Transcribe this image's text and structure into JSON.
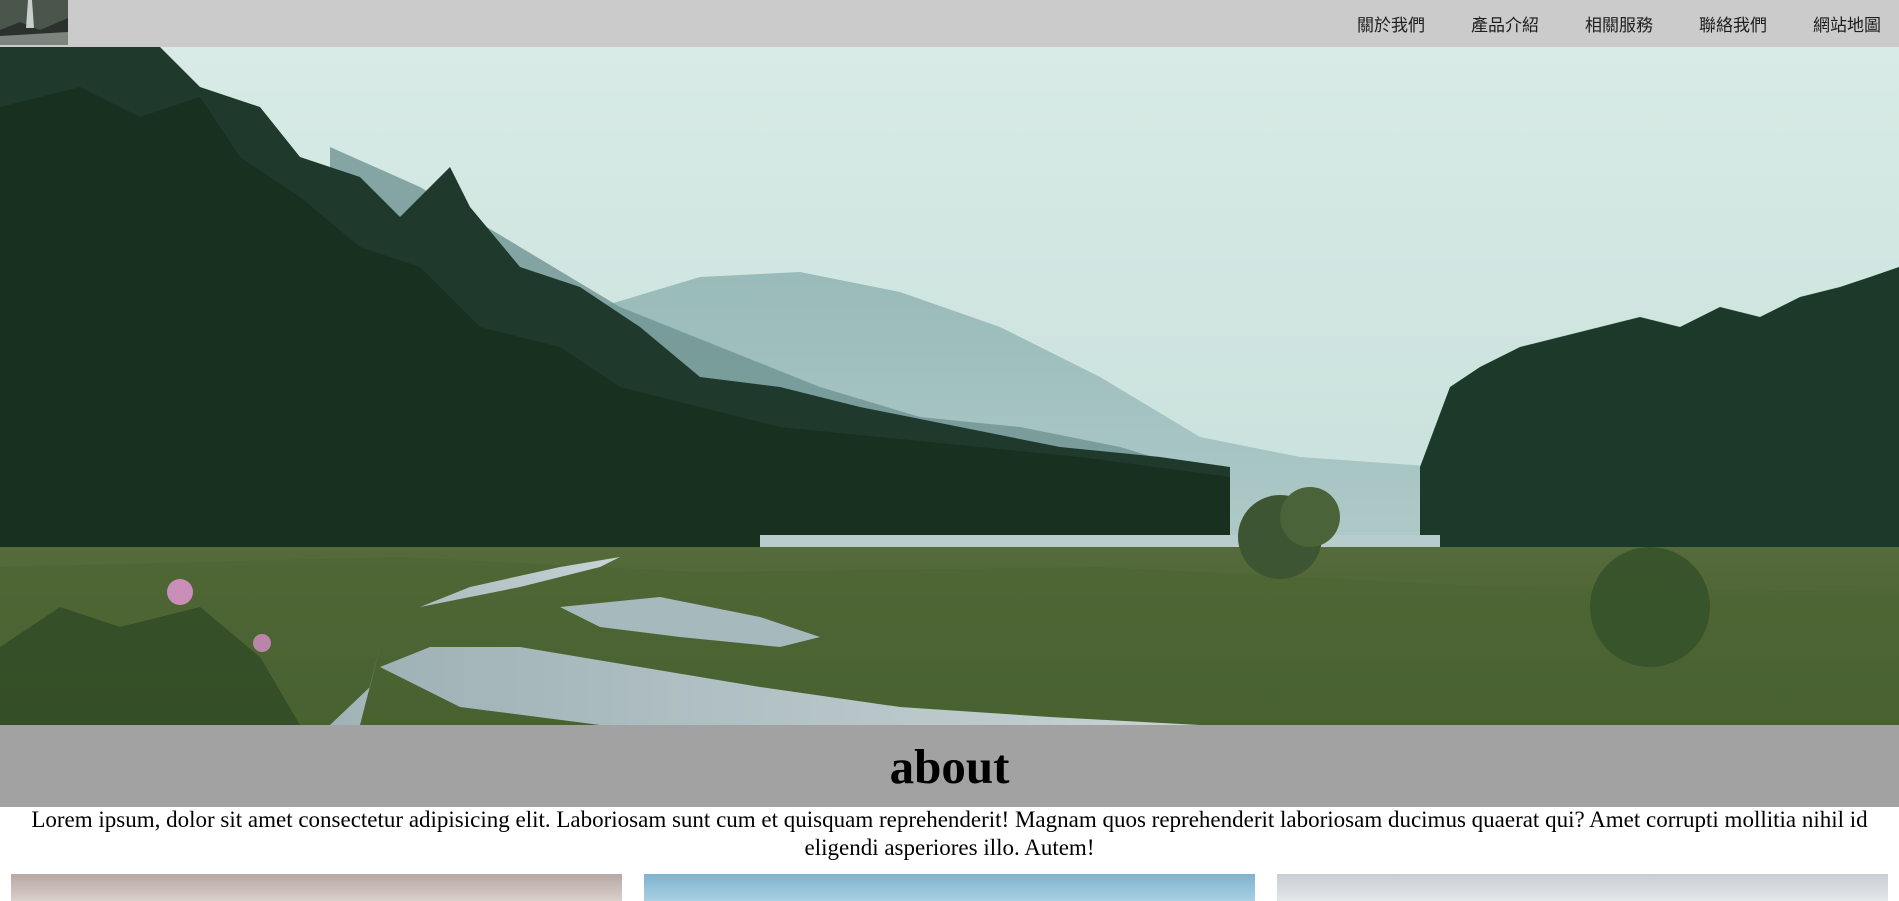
{
  "header": {
    "logo_icon": "waterfall-thumbnail",
    "nav": [
      {
        "label": "關於我們"
      },
      {
        "label": "產品介紹"
      },
      {
        "label": "相關服務"
      },
      {
        "label": "聯絡我們"
      },
      {
        "label": "網站地圖"
      }
    ]
  },
  "hero": {
    "image": "misty-forest-river-landscape"
  },
  "about": {
    "title": "about",
    "text": "Lorem ipsum, dolor sit amet consectetur adipisicing elit. Laboriosam sunt cum et quisquam reprehenderit! Magnam quos reprehenderit laboriosam ducimus quaerat qui? Amet corrupti mollitia nihil id eligendi asperiores illo. Autem!"
  },
  "gallery": [
    "pink-sky-photo",
    "blue-sky-photo",
    "grey-sky-photo"
  ],
  "colors": {
    "topbar": "#cbcbcb",
    "about_bar": "#a2a2a2",
    "nav_text": "#1e1e1e"
  }
}
